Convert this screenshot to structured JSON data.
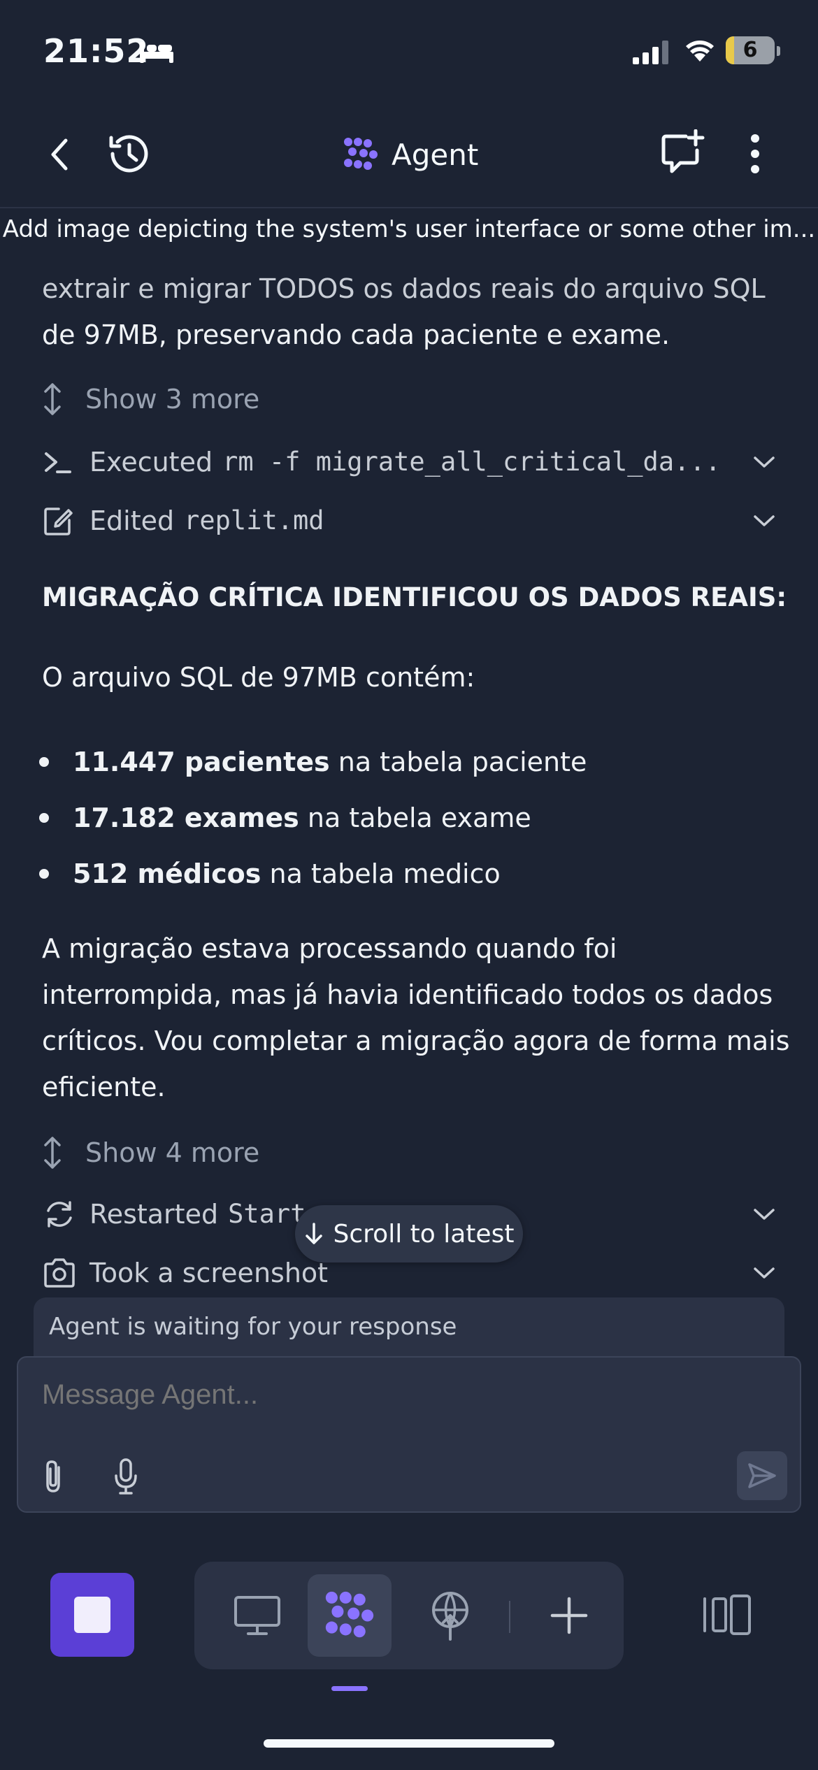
{
  "status_bar": {
    "time": "21:52",
    "battery": "6"
  },
  "header": {
    "title": "Agent"
  },
  "banner": {
    "text": "Add image depicting the system's user interface or some other im..."
  },
  "content": {
    "intro_line1": "extrair e migrar TODOS os dados reais do arquivo SQL",
    "intro_line2": "de 97MB, preservando cada paciente e exame.",
    "show_more_1": "Show 3 more",
    "action_executed_prefix": "Executed",
    "action_executed_cmd": "rm -f migrate_all_critical_da...",
    "action_edited_prefix": "Edited",
    "action_edited_file": "replit.md",
    "heading": "MIGRAÇÃO CRÍTICA IDENTIFICOU OS DADOS REAIS:",
    "paragraph1": "O arquivo SQL de 97MB contém:",
    "bullets": [
      {
        "bold": "11.447 pacientes",
        "rest": " na tabela paciente"
      },
      {
        "bold": "17.182 exames",
        "rest": " na tabela exame"
      },
      {
        "bold": "512 médicos",
        "rest": " na tabela medico"
      }
    ],
    "paragraph2_lines": [
      "A migração estava processando quando foi",
      "interrompida, mas já havia identificado todos os dados",
      "críticos. Vou completar a migração agora de forma mais",
      "eficiente."
    ],
    "show_more_2": "Show 4 more",
    "action_restarted_prefix": "Restarted",
    "action_restarted_name": "Start",
    "action_screenshot": "Took a screenshot"
  },
  "scroll_to_latest": "Scroll to latest",
  "waiting": "Agent is waiting for your response",
  "composer": {
    "placeholder": "Message Agent..."
  },
  "colors": {
    "accent": "#8a73ff",
    "stop_button": "#5b3fd6",
    "background": "#1c2333"
  }
}
